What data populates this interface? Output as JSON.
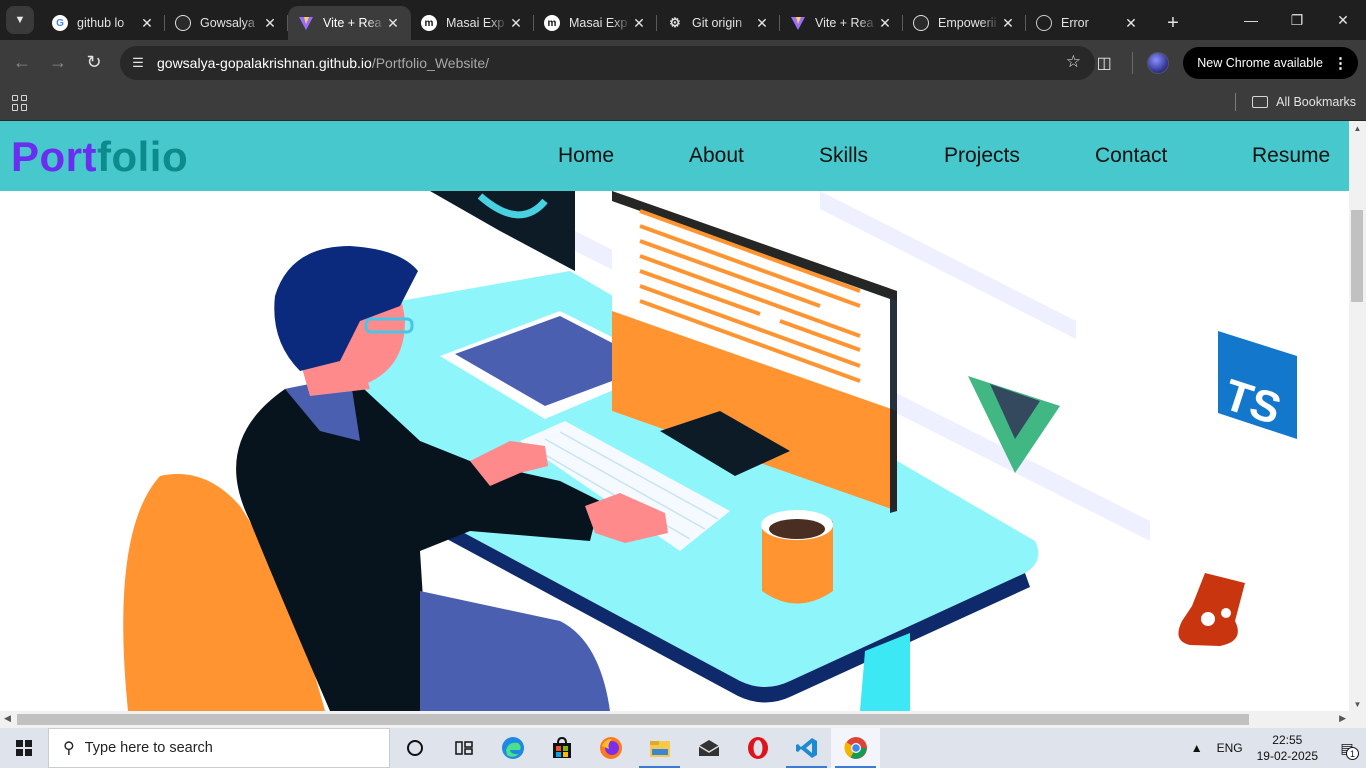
{
  "browser": {
    "tabs": [
      {
        "title": "github lo",
        "icon": "google-icon"
      },
      {
        "title": "Gowsalya",
        "icon": "github-icon"
      },
      {
        "title": "Vite + Rea",
        "icon": "vite-icon",
        "active": true
      },
      {
        "title": "Masai Exp",
        "icon": "masai-icon"
      },
      {
        "title": "Masai Exp",
        "icon": "masai-icon"
      },
      {
        "title": "Git origin",
        "icon": "git-icon"
      },
      {
        "title": "Vite + Rea",
        "icon": "vite-icon"
      },
      {
        "title": "Empowerii",
        "icon": "github-icon"
      },
      {
        "title": "Error",
        "icon": "globe-icon"
      }
    ],
    "url_host": "gowsalya-gopalakrishnan.github.io",
    "url_path": "/Portfolio_Website/",
    "update_label": "New Chrome available",
    "bookmarks_label": "All Bookmarks"
  },
  "site": {
    "brand_part1": "Port",
    "brand_part2": "folio",
    "brand_colors": {
      "part1": "#6b2df0",
      "part2": "#0d8a8c"
    },
    "nav_bg": "#47c8cc",
    "nav": [
      {
        "label": "Home"
      },
      {
        "label": "About"
      },
      {
        "label": "Skills"
      },
      {
        "label": "Projects"
      },
      {
        "label": "Contact"
      },
      {
        "label": "Resume"
      }
    ],
    "hero_badges": {
      "ts": "TS"
    }
  },
  "taskbar": {
    "search_placeholder": "Type here to search",
    "lang": "ENG",
    "time": "22:55",
    "date": "19-02-2025",
    "notifications": "1"
  }
}
